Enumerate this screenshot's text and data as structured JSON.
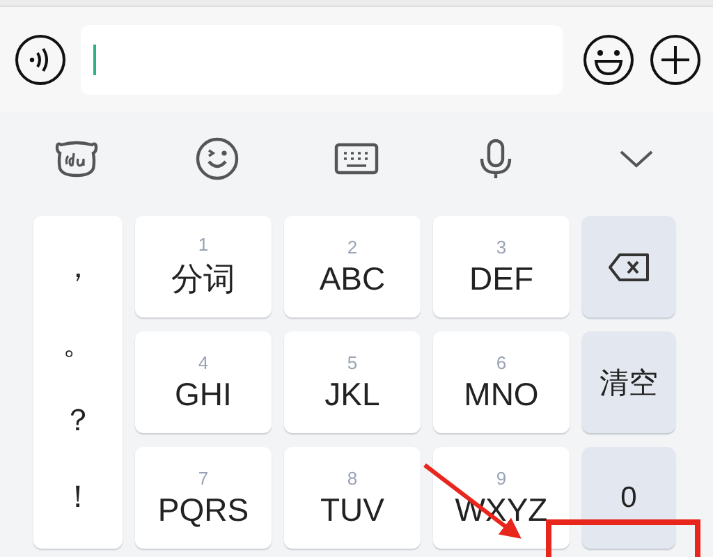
{
  "input_bar": {
    "focused": true
  },
  "keyboard": {
    "punctuation": [
      "，",
      "。",
      "？",
      "！"
    ],
    "keys": [
      {
        "digit": "1",
        "letters": "分词"
      },
      {
        "digit": "2",
        "letters": "ABC"
      },
      {
        "digit": "3",
        "letters": "DEF"
      },
      {
        "digit": "4",
        "letters": "GHI"
      },
      {
        "digit": "5",
        "letters": "JKL"
      },
      {
        "digit": "6",
        "letters": "MNO"
      },
      {
        "digit": "7",
        "letters": "PQRS"
      },
      {
        "digit": "8",
        "letters": "TUV"
      },
      {
        "digit": "9",
        "letters": "WXYZ"
      }
    ],
    "side_keys": [
      {
        "kind": "backspace"
      },
      {
        "kind": "text",
        "label": "清空"
      },
      {
        "kind": "text",
        "label": "0"
      }
    ]
  }
}
